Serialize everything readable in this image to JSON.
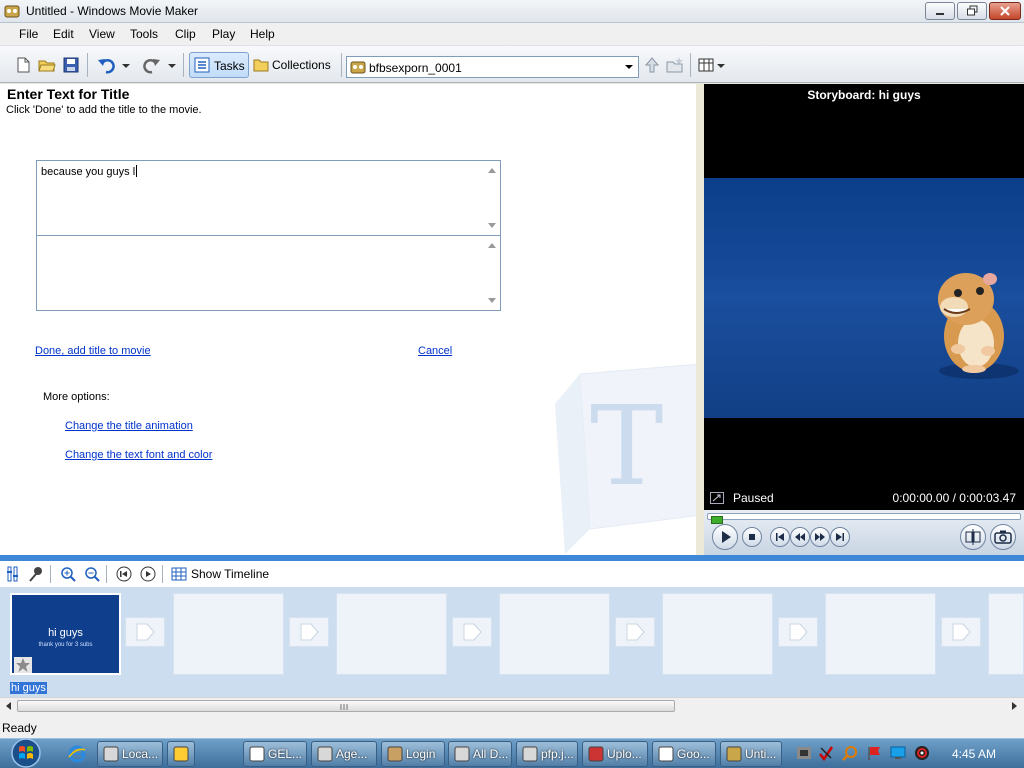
{
  "window": {
    "title": "Untitled - Windows Movie Maker"
  },
  "menu": [
    "File",
    "Edit",
    "View",
    "Tools",
    "Clip",
    "Play",
    "Help"
  ],
  "toolbar": {
    "tasks_label": "Tasks",
    "collections_label": "Collections",
    "collection_value": "bfbsexporn_0001"
  },
  "task_pane": {
    "title": "Enter Text for Title",
    "subtitle": "Click 'Done' to add the title to the movie.",
    "title_text": "because you guys l",
    "subtext": "",
    "done_link": "Done, add title to movie",
    "cancel_link": "Cancel",
    "more_options": "More options:",
    "options": [
      "Change the title animation",
      "Change the text font and color"
    ]
  },
  "preview": {
    "label": "Storyboard: hi guys",
    "state": "Paused",
    "time": "0:00:00.00 / 0:00:03.47"
  },
  "storyboard": {
    "show_timeline": "Show Timeline",
    "clip": {
      "title": "hi guys",
      "subtitle": "thank you for 3 subs",
      "label": "hi guys"
    }
  },
  "status": {
    "text": "Ready"
  },
  "taskbar": {
    "items": [
      "Loca...",
      "GEL...",
      "Age...",
      "Login",
      "All D...",
      "pfp.j...",
      "Uplo...",
      "Goo...",
      "Unti..."
    ],
    "clock": "4:45 AM"
  },
  "colors": {
    "accent": "#3f88d8",
    "preview_blue": "#0f3f8c",
    "link": "#0033cc"
  }
}
